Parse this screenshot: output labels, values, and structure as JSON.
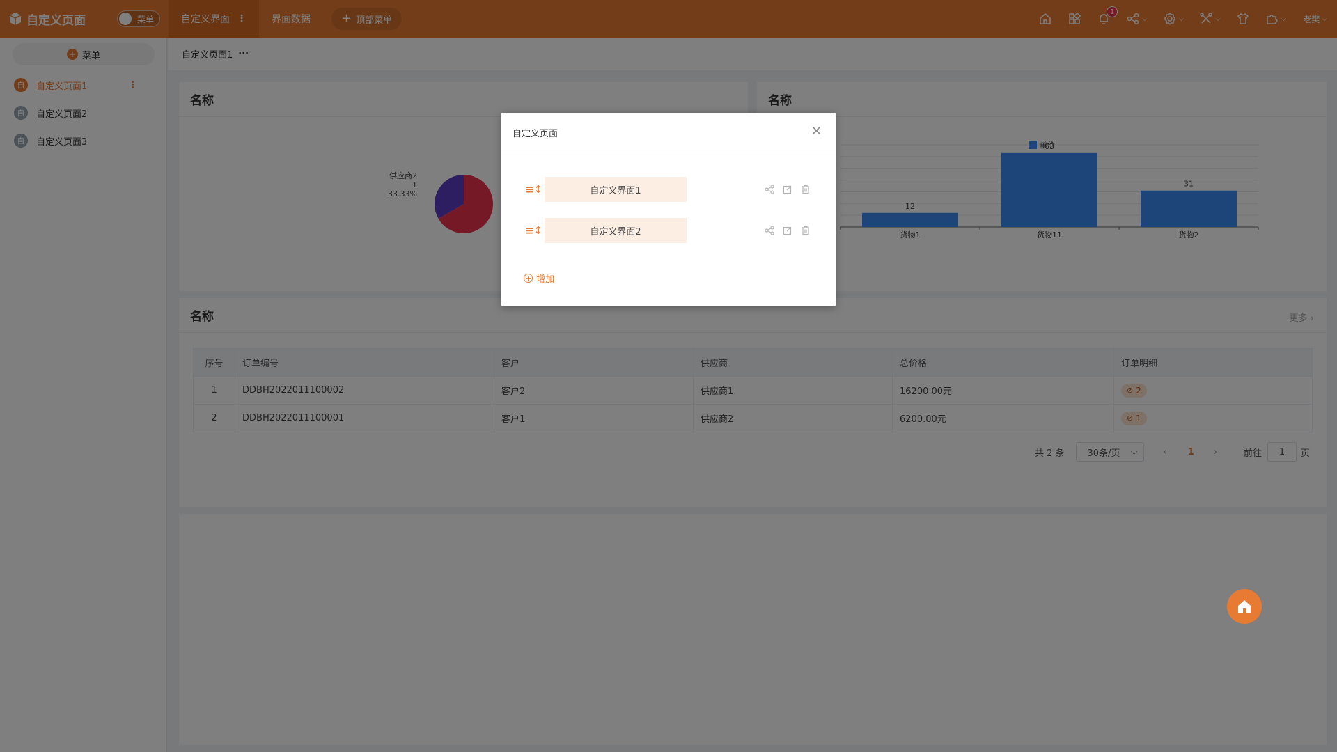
{
  "app": {
    "title": "自定义页面",
    "toggle_label": "菜单"
  },
  "topnav": {
    "items": [
      {
        "label": "自定义界面",
        "active": true
      },
      {
        "label": "界面数据",
        "active": false
      }
    ],
    "add_label": "顶部菜单",
    "bell_count": "1",
    "user_label": "老樊",
    "icons": [
      "home-icon",
      "apps-icon",
      "bell-icon",
      "share-icon",
      "settings-icon",
      "tools-icon",
      "shirt-icon",
      "puzzle-icon"
    ]
  },
  "sidebar": {
    "menu_button": "菜单",
    "items": [
      {
        "label": "自定义页面1",
        "avatar": "自",
        "active": true
      },
      {
        "label": "自定义页面2",
        "avatar": "自",
        "active": false
      },
      {
        "label": "自定义页面3",
        "avatar": "自",
        "active": false
      }
    ]
  },
  "breadcrumb": {
    "current": "自定义页面1",
    "more": "···"
  },
  "cards": {
    "pie": {
      "title": "名称"
    },
    "bar": {
      "title": "名称"
    },
    "table": {
      "title": "名称",
      "more": "更多 ›"
    }
  },
  "chart_data": [
    {
      "type": "pie",
      "title": "",
      "slices": [
        {
          "label": "供应商2",
          "value": 1,
          "percent": "33.33%",
          "color": "#5b3cc4"
        },
        {
          "label": "",
          "value": 2,
          "color": "#e8334a"
        }
      ],
      "visible_label": {
        "name": "供应商2",
        "value": "1",
        "percent": "33.33%"
      }
    },
    {
      "type": "bar",
      "title": "",
      "categories": [
        "货物1",
        "货物11",
        "货物2"
      ],
      "series": [
        {
          "name": "单价",
          "values": [
            12,
            63,
            31
          ],
          "color": "#3d8bf2"
        }
      ],
      "ylim": [
        0,
        70
      ],
      "legend": "top-center",
      "grid": true
    }
  ],
  "table": {
    "headers": [
      "序号",
      "订单编号",
      "客户",
      "供应商",
      "总价格",
      "订单明细"
    ],
    "rows": [
      {
        "no": "1",
        "order": "DDBH2022011100002",
        "customer": "客户2",
        "supplier": "供应商1",
        "total": "16200.00元",
        "detail": "2"
      },
      {
        "no": "2",
        "order": "DDBH2022011100001",
        "customer": "客户1",
        "supplier": "供应商2",
        "total": "6200.00元",
        "detail": "1"
      }
    ]
  },
  "pagination": {
    "total": "共 2 条",
    "page_size": "30条/页",
    "current": "1",
    "goto_label": "前往",
    "goto_value": "1",
    "page_suffix": "页"
  },
  "modal": {
    "title": "自定义页面",
    "items": [
      "自定义界面1",
      "自定义界面2"
    ],
    "add_label": "增加"
  },
  "colors": {
    "accent": "#e87b33",
    "active_tab": "#d96a22",
    "bar": "#3d8bf2",
    "pie_a": "#5b3cc4",
    "pie_b": "#e8334a"
  }
}
